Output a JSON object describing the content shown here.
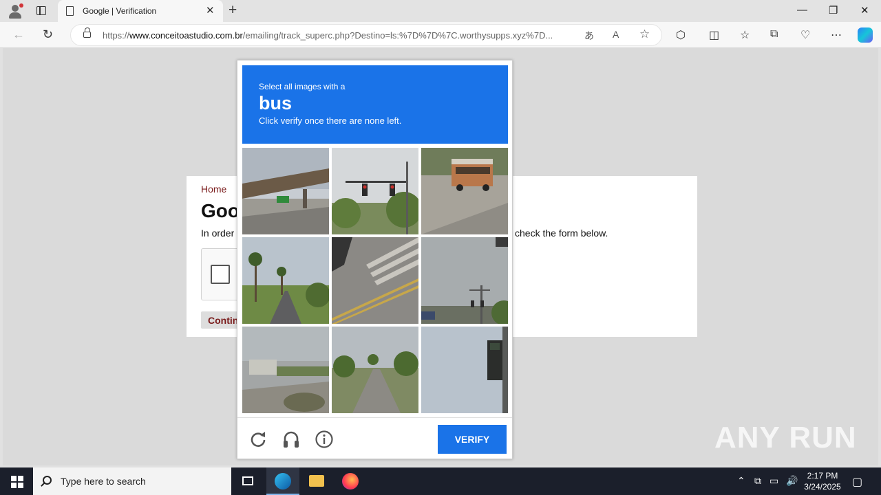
{
  "browser": {
    "tab_title": "Google | Verification",
    "url_prefix": "https://",
    "url_domain": "www.conceitoastudio.com.br",
    "url_path": "/emailing/track_superc.php?Destino=ls:%7D%7D%7C.worthysupps.xyz%7D..."
  },
  "page": {
    "breadcrumb": "Home",
    "title_visible": "Goo",
    "intro_visible": "In order",
    "intro_tail": "check the form below.",
    "continue_visible": "Contin"
  },
  "captcha": {
    "prompt_small": "Select all images with a",
    "prompt_target": "bus",
    "prompt_sub": "Click verify once there are none left.",
    "verify_label": "VERIFY",
    "header_color": "#1a73e8",
    "tiles": [
      "overpass-with-highway-sign",
      "traffic-light-with-trees",
      "bus-on-road",
      "palm-tree-street",
      "crosswalk-with-car",
      "traffic-light-cloudy-sky",
      "parking-lot-building",
      "tree-lined-road",
      "traffic-signal-closeup"
    ]
  },
  "watermark": "ANY RUN",
  "taskbar": {
    "search_placeholder": "Type here to search",
    "time": "2:17 PM",
    "date": "3/24/2025"
  }
}
